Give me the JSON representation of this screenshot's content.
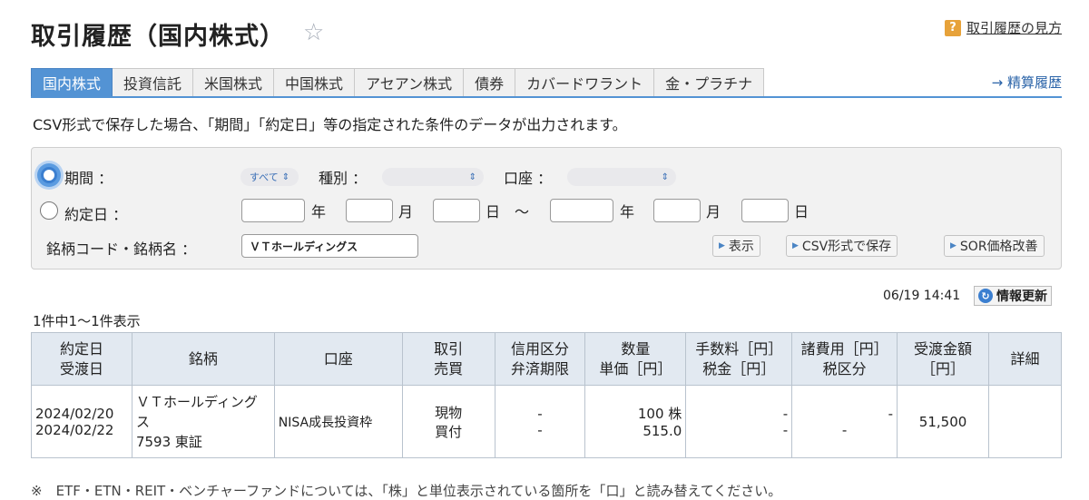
{
  "header": {
    "title": "取引履歴（国内株式）",
    "help_label": "取引履歴の見方",
    "help_icon": "?"
  },
  "tabs": [
    {
      "label": "国内株式",
      "active": true
    },
    {
      "label": "投資信託"
    },
    {
      "label": "米国株式"
    },
    {
      "label": "中国株式"
    },
    {
      "label": "アセアン株式"
    },
    {
      "label": "債券"
    },
    {
      "label": "カバードワラント"
    },
    {
      "label": "金・プラチナ"
    }
  ],
  "settle_link": "→ 精算履歴",
  "notice": "CSV形式で保存した場合、「期間」「約定日」等の指定された条件のデータが出力されます。",
  "search": {
    "period_label": "期間 ：",
    "period_value": "すべて",
    "type_label": "種別 ：",
    "account_label": "口座 ：",
    "date_label": "約定日 ：",
    "year": "年",
    "month": "月",
    "day": "日",
    "tilde": "〜",
    "code_label": "銘柄コード・銘柄名 ：",
    "code_value": "ＶＴホールディングス",
    "btn_show": "表示",
    "btn_csv": "CSV形式で保存",
    "btn_sor": "SOR価格改善"
  },
  "timestamp": "06/19 14:41",
  "refresh_label": "情報更新",
  "count_text": "1件中1〜1件表示",
  "table": {
    "headers": [
      [
        "約定日",
        "受渡日"
      ],
      [
        "銘柄"
      ],
      [
        "口座"
      ],
      [
        "取引",
        "売買"
      ],
      [
        "信用区分",
        "弁済期限"
      ],
      [
        "数量",
        "単価［円］"
      ],
      [
        "手数料［円］",
        "税金［円］"
      ],
      [
        "諸費用［円］",
        "税区分"
      ],
      [
        "受渡金額",
        "［円］"
      ],
      [
        "詳細"
      ]
    ],
    "rows": [
      {
        "trade_date": "2024/02/20",
        "settle_date": "2024/02/22",
        "name": "ＶＴホールディングス",
        "code_market": "7593 東証",
        "account": "NISA成長投資枠",
        "trade": "現物",
        "side": "買付",
        "credit": "-",
        "due": "-",
        "qty": "100 株",
        "price": "515.0",
        "fee": "-",
        "tax": "-",
        "other_fee": "-",
        "tax_type": "-",
        "amount": "51,500",
        "detail": ""
      }
    ]
  },
  "footnote": "※　ETF・ETN・REIT・ベンチャーファンドについては、「株」と単位表示されている箇所を「口」と読み替えてください。"
}
